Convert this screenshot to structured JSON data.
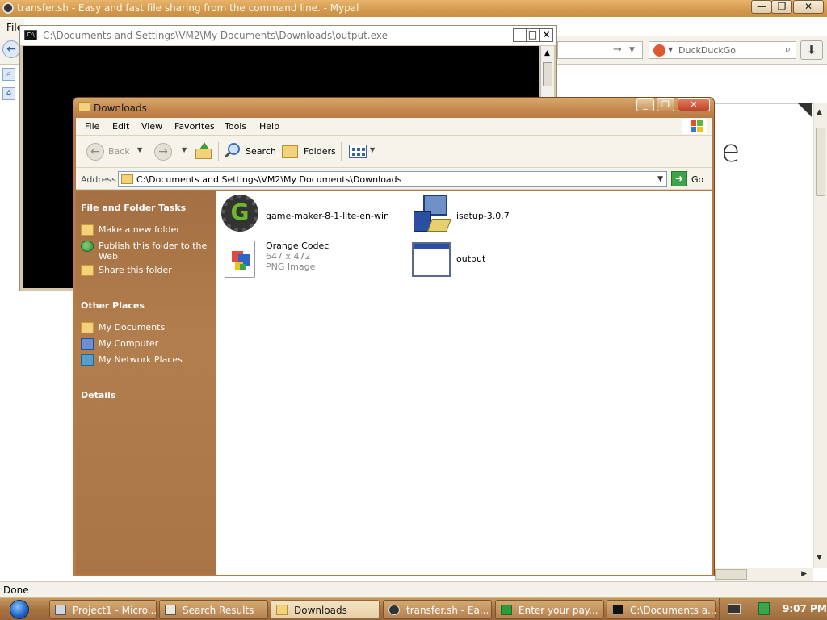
{
  "browser": {
    "title": "transfer.sh - Easy and fast file sharing from the command line. - Mypal",
    "menu_first": "File",
    "search_placeholder": "DuckDuckGo",
    "page_glyph": "e",
    "status": "Done"
  },
  "console": {
    "title": "C:\\Documents and Settings\\VM2\\My Documents\\Downloads\\output.exe"
  },
  "explorer": {
    "title": "Downloads",
    "menu": [
      "File",
      "Edit",
      "View",
      "Favorites",
      "Tools",
      "Help"
    ],
    "toolbar": {
      "back": "Back",
      "search": "Search",
      "folders": "Folders"
    },
    "address": {
      "label": "Address",
      "path": "C:\\Documents and Settings\\VM2\\My Documents\\Downloads",
      "go": "Go"
    },
    "tasks": {
      "file_folder_heading": "File and Folder Tasks",
      "file_folder_items": [
        "Make a new folder",
        "Publish this folder to the Web",
        "Share this folder"
      ],
      "other_places_heading": "Other Places",
      "other_places_items": [
        "My Documents",
        "My Computer",
        "My Network Places"
      ],
      "details_heading": "Details"
    },
    "files": [
      {
        "name": "game-maker-8-1-lite-en-win",
        "icon": "game-maker-icon"
      },
      {
        "name": "isetup-3.0.7",
        "icon": "installer-icon"
      },
      {
        "name": "Orange Codec",
        "line2": "647 x 472",
        "line3": "PNG Image",
        "icon": "png-image-icon"
      },
      {
        "name": "output",
        "icon": "exe-window-icon"
      }
    ]
  },
  "taskbar": {
    "buttons": [
      {
        "label": "Project1 - Micro..."
      },
      {
        "label": "Search Results"
      },
      {
        "label": "Downloads",
        "active": true
      },
      {
        "label": "transfer.sh - Ea..."
      },
      {
        "label": "Enter your pay..."
      },
      {
        "label": "C:\\Documents a..."
      }
    ],
    "clock": "9:07 PM"
  }
}
